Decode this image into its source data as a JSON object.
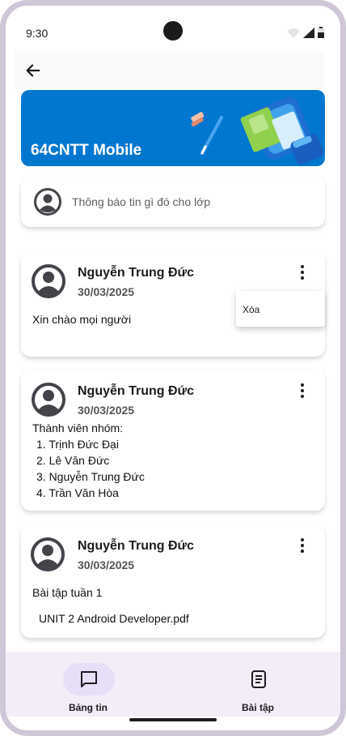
{
  "status_bar": {
    "time": "9:30"
  },
  "app_bar": {
    "back_icon": "arrow-left-icon"
  },
  "banner": {
    "title": "64CNTT Mobile",
    "color": "#0277CF"
  },
  "announce": {
    "placeholder": "Thông báo tin gì đó cho lớp"
  },
  "posts": [
    {
      "author": "Nguyễn Trung Đức",
      "date": "30/03/2025",
      "body": "Xin chào mọi người"
    },
    {
      "author": "Nguyễn Trung Đức",
      "date": "30/03/2025",
      "body": "Thành viên nhóm:",
      "list": [
        "1. Trịnh Đức Đại",
        "2. Lê Văn Đức",
        "3. Nguyễn Trung Đức",
        "4. Trần Văn Hòa"
      ]
    },
    {
      "author": "Nguyễn Trung Đức",
      "date": "30/03/2025",
      "body": "Bài tập tuần 1",
      "attachment": "UNIT 2 Android Developer.pdf"
    }
  ],
  "context_menu": {
    "delete_label": "Xóa"
  },
  "bottom_nav": {
    "items": [
      {
        "label": "Bảng tin",
        "icon": "message-square-icon",
        "selected": true
      },
      {
        "label": "Bài tập",
        "icon": "document-icon",
        "selected": false
      }
    ],
    "selected_color": "#E8DEF8",
    "background_color": "#F3EDF7"
  }
}
